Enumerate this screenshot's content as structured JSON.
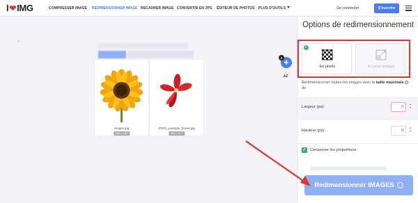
{
  "brand": {
    "logo_i": "I",
    "logo_heart": "❤",
    "logo_text": "IMG"
  },
  "nav": {
    "items": [
      {
        "label": "COMPRESSER IMAGE"
      },
      {
        "label": "REDIMENSIONNER IMAGE",
        "active": true
      },
      {
        "label": "RECADRER IMAGE"
      },
      {
        "label": "CONVERTIR EN JPG"
      },
      {
        "label": "ÉDITEUR DE PHOTOS"
      },
      {
        "label": "PLUS D'OUTILS"
      }
    ],
    "login": "Se connecter",
    "signup": "S'inscrire"
  },
  "workspace": {
    "file_count": "2",
    "add_icon": "plus-icon",
    "sort_icon": "sort-az-icon",
    "files": [
      {
        "name": "images.jpg",
        "dims": "183 x 183",
        "icon": "sunflower-image"
      },
      {
        "name": "JPEG_example_flower.jpg",
        "dims": "500 x 417",
        "icon": "red-flower-image"
      }
    ]
  },
  "panel": {
    "title": "Options de redimensionnement",
    "options": [
      {
        "label": "En pixels",
        "selected": true,
        "icon": "pixels-icon"
      },
      {
        "label": "En pourcentage",
        "selected": false,
        "icon": "percentage-icon"
      }
    ],
    "description_prefix": "Redimensionner toutes les images avec la ",
    "description_bold": "taille maximale",
    "description_suffix": " de",
    "width_label": "Largeur (px):",
    "width_value": "0",
    "height_label": "Hauteur (px):",
    "height_value": "0",
    "keep_ratio_label": "Conserver les proportions",
    "keep_ratio_checked": true,
    "action_label": "Redimensionner IMAGES"
  },
  "colors": {
    "accent": "#4a7cf6",
    "action_disabled": "#8fb0f5",
    "highlight": "#e5322d",
    "success": "#34b26b"
  }
}
